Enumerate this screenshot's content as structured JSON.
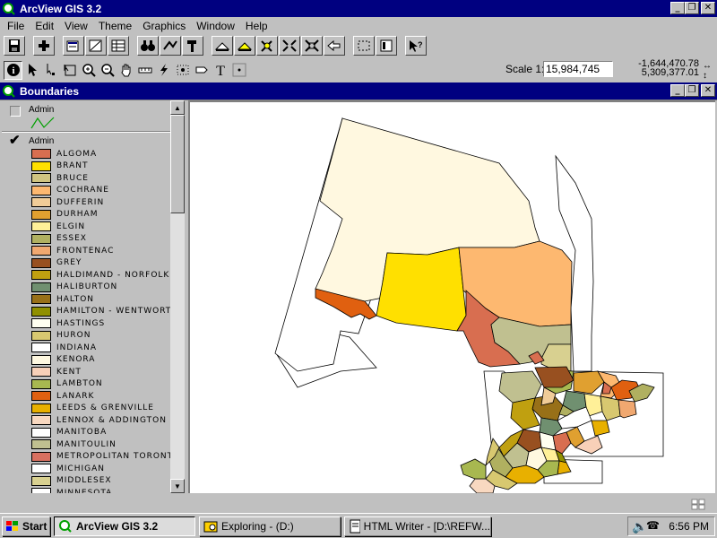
{
  "app": {
    "title": "ArcView GIS 3.2"
  },
  "menu": [
    "File",
    "Edit",
    "View",
    "Theme",
    "Graphics",
    "Window",
    "Help"
  ],
  "menu_underline": [
    "F",
    "E",
    "V",
    "T",
    "G",
    "W",
    "H"
  ],
  "scale": {
    "label": "Scale 1:",
    "value": "15,984,745"
  },
  "coords": {
    "x": "-1,644,470.78",
    "y": "5,309,377.01"
  },
  "view": {
    "title": "Boundaries"
  },
  "themes": [
    {
      "name": "Admin",
      "checked": false,
      "symbol": "line",
      "color": "#00a000"
    },
    {
      "name": "Admin",
      "checked": true
    }
  ],
  "legend": [
    {
      "label": "ALGOMA",
      "color": "#d86e50"
    },
    {
      "label": "BRANT",
      "color": "#ffe000"
    },
    {
      "label": "BRUCE",
      "color": "#d0c480"
    },
    {
      "label": "COCHRANE",
      "color": "#fdb870"
    },
    {
      "label": "DUFFERIN",
      "color": "#f0cc98"
    },
    {
      "label": "DURHAM",
      "color": "#e0a030"
    },
    {
      "label": "ELGIN",
      "color": "#fff098"
    },
    {
      "label": "ESSEX",
      "color": "#b0b060"
    },
    {
      "label": "FRONTENAC",
      "color": "#f0a870"
    },
    {
      "label": "GREY",
      "color": "#985020"
    },
    {
      "label": "HALDIMAND - NORFOLK",
      "color": "#c0a010"
    },
    {
      "label": "HALIBURTON",
      "color": "#709070"
    },
    {
      "label": "HALTON",
      "color": "#987018"
    },
    {
      "label": "HAMILTON - WENTWORTH",
      "color": "#909000"
    },
    {
      "label": "HASTINGS",
      "color": "#fffff0"
    },
    {
      "label": "HURON",
      "color": "#d8c870"
    },
    {
      "label": "INDIANA",
      "color": "#ffffff"
    },
    {
      "label": "KENORA",
      "color": "#fff8e0"
    },
    {
      "label": "KENT",
      "color": "#f8d0b8"
    },
    {
      "label": "LAMBTON",
      "color": "#a8b850"
    },
    {
      "label": "LANARK",
      "color": "#e06010"
    },
    {
      "label": "LEEDS & GRENVILLE",
      "color": "#e8b000"
    },
    {
      "label": "LENNOX & ADDINGTON",
      "color": "#f8d8c0"
    },
    {
      "label": "MANITOBA",
      "color": "#ffffff"
    },
    {
      "label": "MANITOULIN",
      "color": "#c0c090"
    },
    {
      "label": "METROPOLITAN TORONTO",
      "color": "#d87060"
    },
    {
      "label": "MICHIGAN",
      "color": "#ffffff"
    },
    {
      "label": "MIDDLESEX",
      "color": "#d8d090"
    },
    {
      "label": "MINNESOTA",
      "color": "#ffffff"
    }
  ],
  "taskbar": {
    "start": "Start",
    "items": [
      {
        "label": "ArcView GIS 3.2",
        "active": true
      },
      {
        "label": "Exploring - (D:)",
        "active": false
      },
      {
        "label": "HTML Writer - [D:\\REFW...",
        "active": false
      }
    ],
    "clock": "6:56 PM"
  }
}
